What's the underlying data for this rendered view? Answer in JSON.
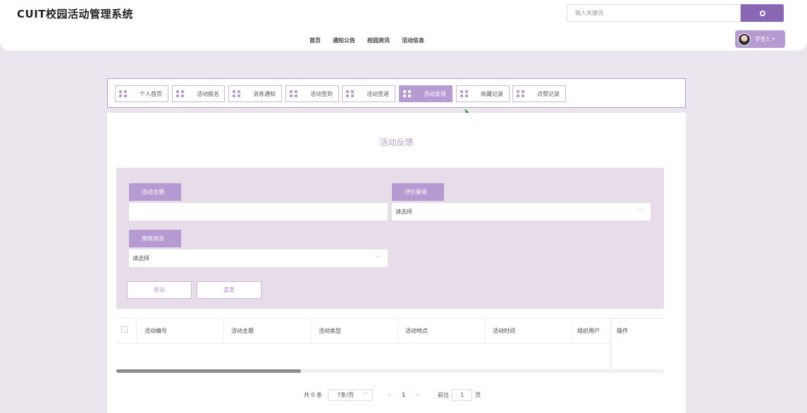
{
  "header": {
    "brand": "CUIT校园活动管理系统",
    "search_placeholder": "输入关键词",
    "nav": [
      "首页",
      "通知公告",
      "校园资讯",
      "活动信息"
    ],
    "user": "学生1",
    "colors": {
      "accent": "#8a67b5",
      "accent_light": "#b69bd2"
    }
  },
  "tabs": [
    "个人首页",
    "活动报名",
    "消息通知",
    "活动签到",
    "活动签退",
    "活动反馈",
    "收藏记录",
    "点赞记录"
  ],
  "active_tab": "活动反馈",
  "page_title": "活动反馈",
  "form": {
    "topic_label": "活动主题",
    "topic_value": "",
    "rating_label": "评价星级",
    "rating_value": "请选择",
    "status_label": "审核状态",
    "status_value": "请选择",
    "query_button": "查询",
    "reset_button": "重置"
  },
  "table": {
    "columns": [
      "活动编号",
      "活动主题",
      "活动类型",
      "活动地点",
      "活动时间",
      "组织用户",
      "操作"
    ],
    "rows": []
  },
  "pagination": {
    "total": "共 0 条",
    "page_size": "7条/页",
    "prev": "<",
    "current": "1",
    "next": ">",
    "goto": "前往",
    "goto_value": "1",
    "unit": "页"
  }
}
